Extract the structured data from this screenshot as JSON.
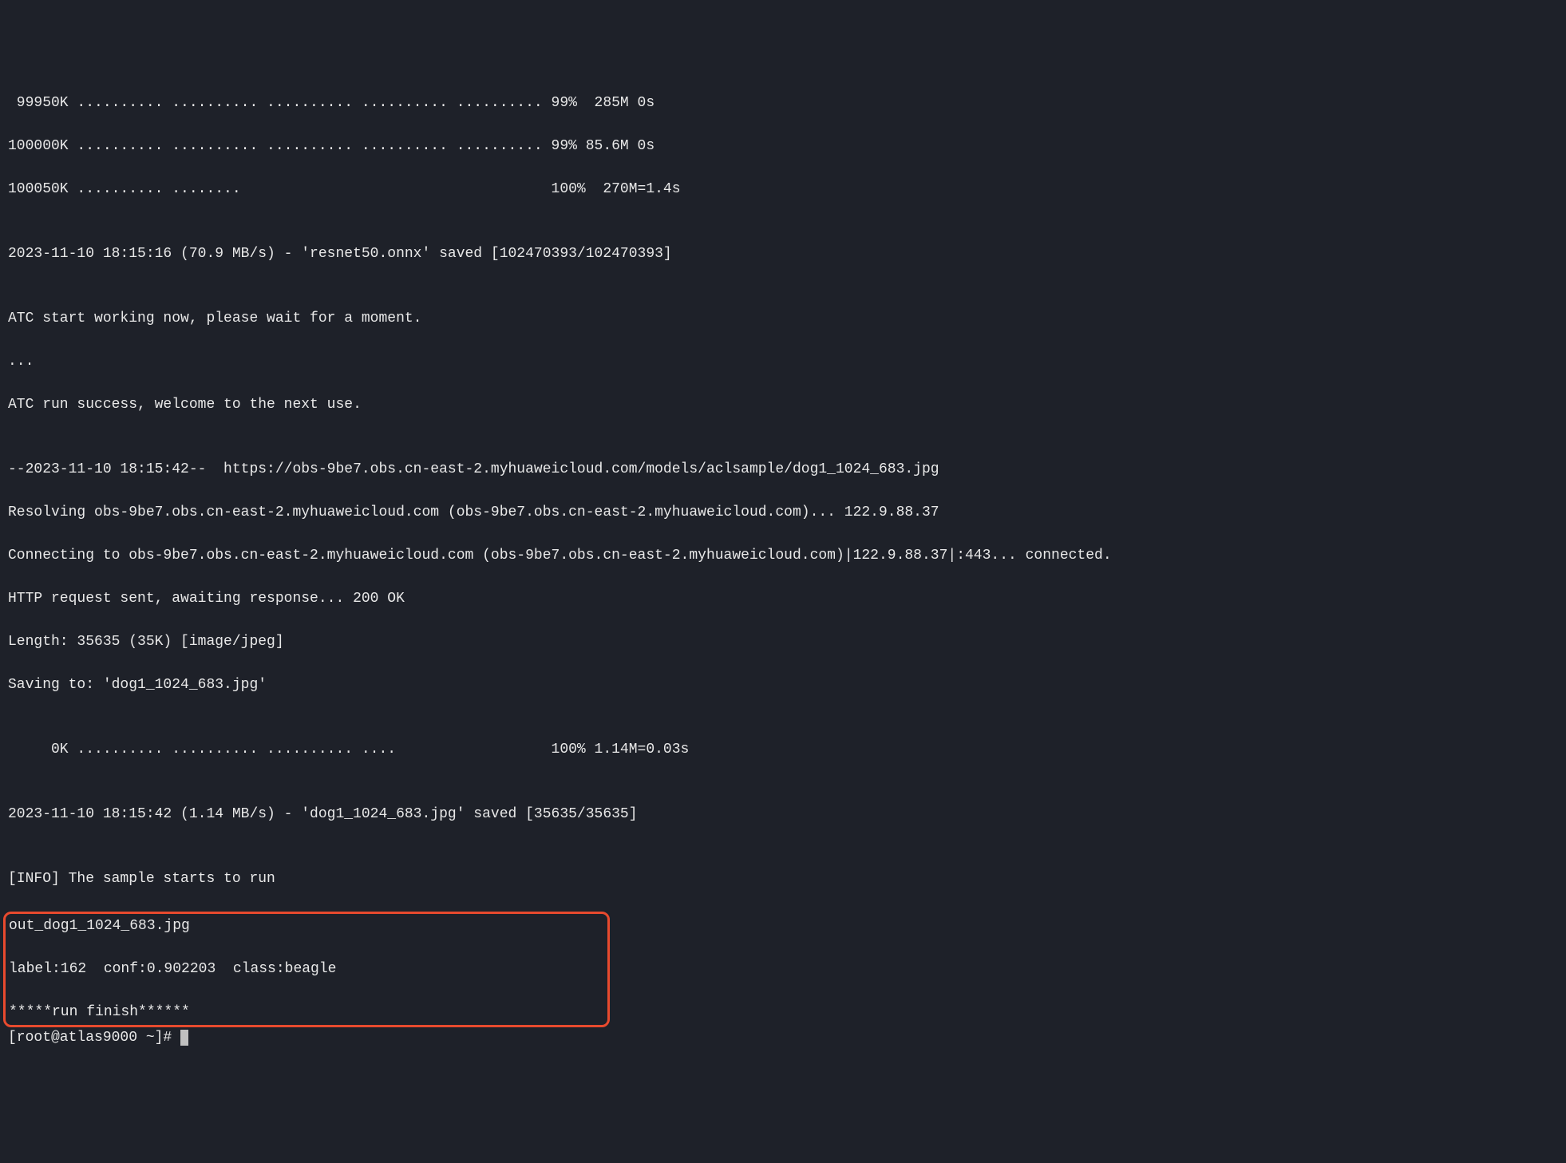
{
  "lines": {
    "l1": " 99950K .......... .......... .......... .......... .......... 99%  285M 0s",
    "l2": "100000K .......... .......... .......... .......... .......... 99% 85.6M 0s",
    "l3": "100050K .......... ........                                    100%  270M=1.4s",
    "l4": "",
    "l5": "2023-11-10 18:15:16 (70.9 MB/s) - 'resnet50.onnx' saved [102470393/102470393]",
    "l6": "",
    "l7": "ATC start working now, please wait for a moment.",
    "l8": "...",
    "l9": "ATC run success, welcome to the next use.",
    "l10": "",
    "l11": "--2023-11-10 18:15:42--  https://obs-9be7.obs.cn-east-2.myhuaweicloud.com/models/aclsample/dog1_1024_683.jpg",
    "l12": "Resolving obs-9be7.obs.cn-east-2.myhuaweicloud.com (obs-9be7.obs.cn-east-2.myhuaweicloud.com)... 122.9.88.37",
    "l13": "Connecting to obs-9be7.obs.cn-east-2.myhuaweicloud.com (obs-9be7.obs.cn-east-2.myhuaweicloud.com)|122.9.88.37|:443... connected.",
    "l14": "HTTP request sent, awaiting response... 200 OK",
    "l15": "Length: 35635 (35K) [image/jpeg]",
    "l16": "Saving to: 'dog1_1024_683.jpg'",
    "l17": "",
    "l18": "     0K .......... .......... .......... ....                  100% 1.14M=0.03s",
    "l19": "",
    "l20": "2023-11-10 18:15:42 (1.14 MB/s) - 'dog1_1024_683.jpg' saved [35635/35635]",
    "l21": "",
    "l22": "[INFO] The sample starts to run"
  },
  "highlighted": {
    "h1": "out_dog1_1024_683.jpg",
    "h2": "label:162  conf:0.902203  class:beagle",
    "h3": "*****run finish******"
  },
  "prompt": "[root@atlas9000 ~]# "
}
